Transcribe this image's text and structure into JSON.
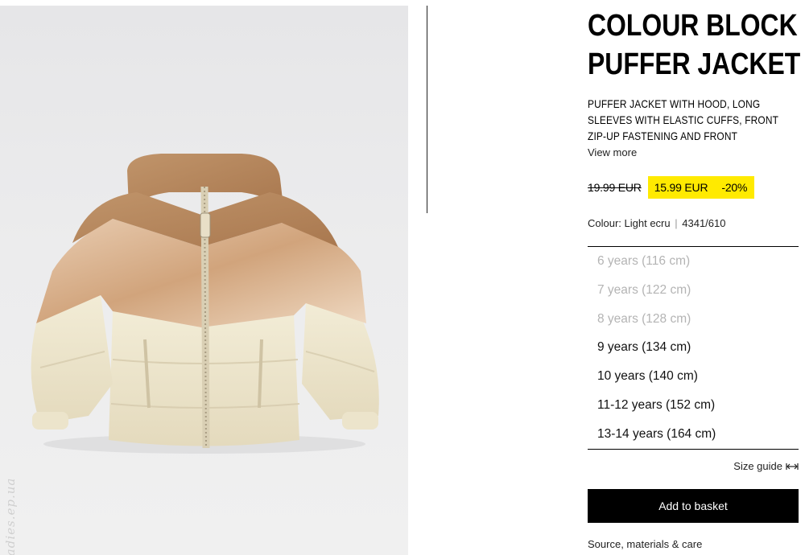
{
  "product": {
    "title_line1": "COLOUR BLOCK",
    "title_line2": "PUFFER JACKET",
    "description": "PUFFER JACKET WITH HOOD, LONG SLEEVES WITH ELASTIC CUFFS, FRONT ZIP-UP FASTENING AND FRONT",
    "view_more": "View more",
    "old_price": "19.99 EUR",
    "new_price": "15.99 EUR",
    "discount": "-20%",
    "colour_label": "Colour: Light ecru",
    "colour_separator": "|",
    "reference": "4341/610",
    "sale_color": "#ffea00"
  },
  "sizes": [
    {
      "label": "6 years (116 cm)",
      "available": false
    },
    {
      "label": "7 years (122 cm)",
      "available": false
    },
    {
      "label": "8 years (128 cm)",
      "available": false
    },
    {
      "label": "9 years (134 cm)",
      "available": true
    },
    {
      "label": "10 years (140 cm)",
      "available": true
    },
    {
      "label": "11-12 years (152 cm)",
      "available": true
    },
    {
      "label": "13-14 years (164 cm)",
      "available": true
    }
  ],
  "actions": {
    "size_guide": "Size guide",
    "size_guide_icon": "ruler-arrows-icon",
    "add_to_basket": "Add to basket",
    "care": "Source, materials & care"
  },
  "image": {
    "subject_icon": "puffer-jacket-photo",
    "watermark": "ladies.ep.ua"
  }
}
